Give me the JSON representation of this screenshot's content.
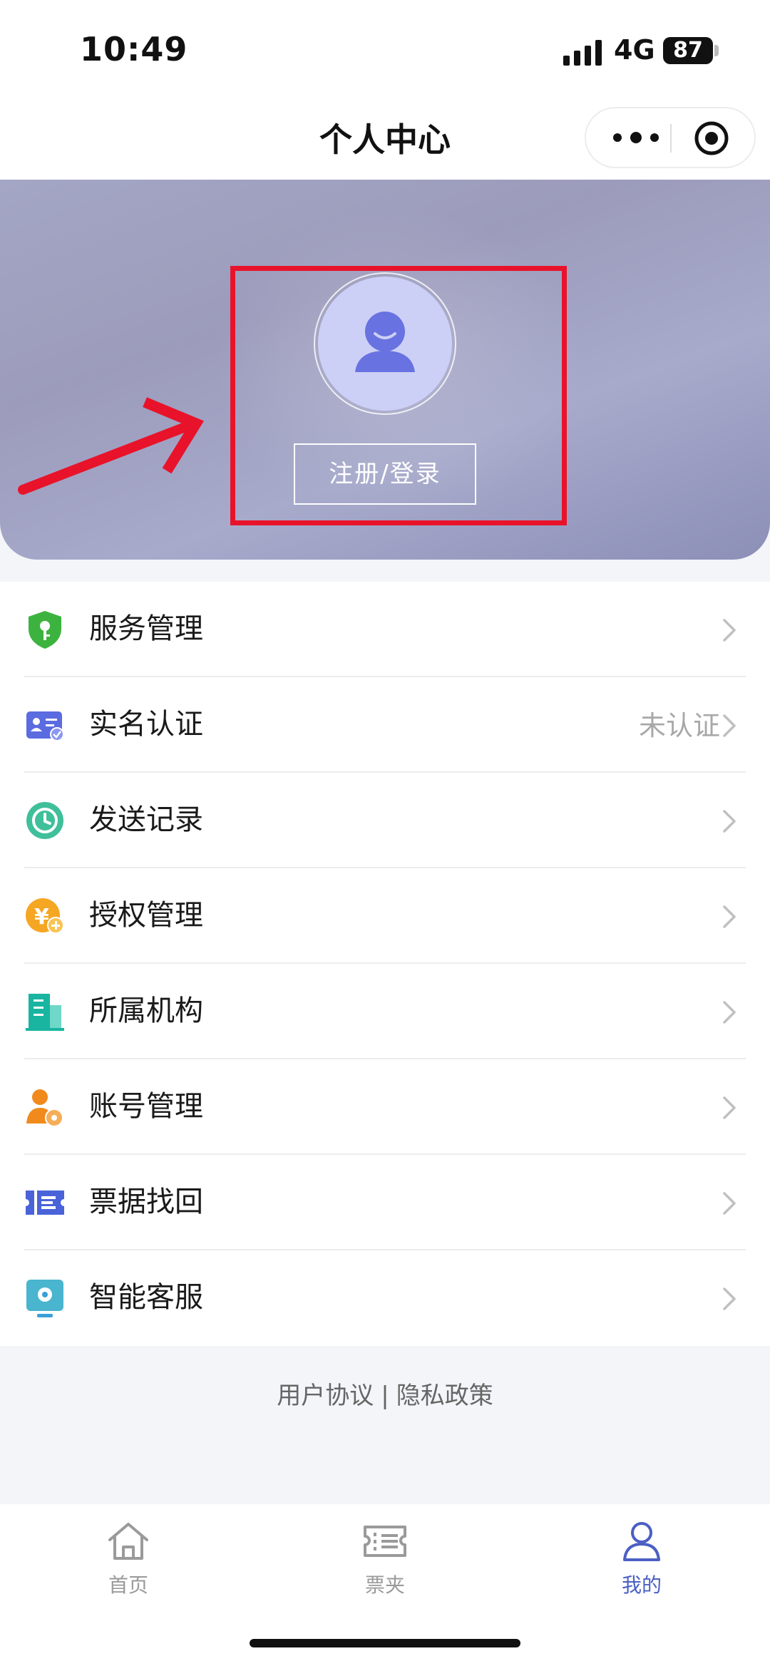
{
  "status_bar": {
    "time": "10:49",
    "network": "4G",
    "battery": "87"
  },
  "nav": {
    "title": "个人中心",
    "more_icon": "more-dots-icon",
    "close_icon": "target-icon"
  },
  "profile": {
    "login_label": "注册/登录",
    "avatar_icon": "user-avatar-icon"
  },
  "menu": [
    {
      "label": "服务管理",
      "value": "",
      "icon": "shield-key-icon",
      "color": "#3db33f"
    },
    {
      "label": "实名认证",
      "value": "未认证",
      "icon": "id-card-icon",
      "color": "#5b6be0"
    },
    {
      "label": "发送记录",
      "value": "",
      "icon": "clock-icon",
      "color": "#3fbf9a"
    },
    {
      "label": "授权管理",
      "value": "",
      "icon": "yen-plus-icon",
      "color": "#f5a623"
    },
    {
      "label": "所属机构",
      "value": "",
      "icon": "building-icon",
      "color": "#19b5a0"
    },
    {
      "label": "账号管理",
      "value": "",
      "icon": "user-gear-icon",
      "color": "#f08a1c"
    },
    {
      "label": "票据找回",
      "value": "",
      "icon": "ticket-icon",
      "color": "#4a63d8"
    },
    {
      "label": "智能客服",
      "value": "",
      "icon": "service-screen-icon",
      "color": "#3a9fd8"
    }
  ],
  "footer": {
    "agreement": "用户协议",
    "separator": "|",
    "privacy": "隐私政策"
  },
  "tabs": [
    {
      "label": "首页",
      "icon": "home-icon",
      "active": false
    },
    {
      "label": "票夹",
      "icon": "ticket-folder-icon",
      "active": false
    },
    {
      "label": "我的",
      "icon": "user-icon",
      "active": true
    }
  ],
  "colors": {
    "accent": "#4b5fc4",
    "highlight": "#e8132a",
    "banner": "#9c9bbb"
  }
}
